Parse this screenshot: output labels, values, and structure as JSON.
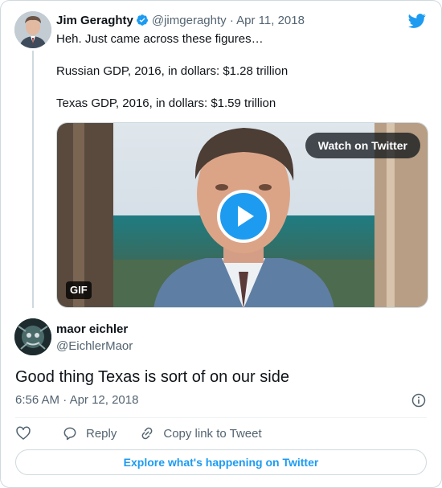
{
  "colors": {
    "accent": "#1d9bf0",
    "text": "#0f1419",
    "muted": "#536471",
    "border": "#cfd9de"
  },
  "tweet": {
    "author_name": "Jim Geraghty",
    "author_handle": "@jimgeraghty",
    "separator": "·",
    "date": "Apr 11, 2018",
    "verified_icon": "verified-badge-icon",
    "lines": [
      "Heh. Just came across these figures…",
      "Russian GDP, 2016, in dollars: $1.28 trillion",
      "Texas GDP, 2016, in dollars: $1.59 trillion"
    ],
    "media": {
      "watch_label": "Watch on Twitter",
      "gif_label": "GIF",
      "play_icon": "play-icon"
    }
  },
  "reply": {
    "author_name": "maor eichler",
    "author_handle": "@EichlerMaor",
    "text": "Good thing Texas is sort of on our side",
    "time": "6:56 AM",
    "separator": "·",
    "date": "Apr 12, 2018"
  },
  "actions": {
    "like_icon": "heart-icon",
    "reply_label": "Reply",
    "reply_icon": "reply-bubble-icon",
    "copy_label": "Copy link to Tweet",
    "copy_icon": "link-icon",
    "info_icon": "info-icon"
  },
  "footer": {
    "explore_label": "Explore what's happening on Twitter"
  },
  "brand": {
    "logo_icon": "twitter-bird-icon"
  }
}
